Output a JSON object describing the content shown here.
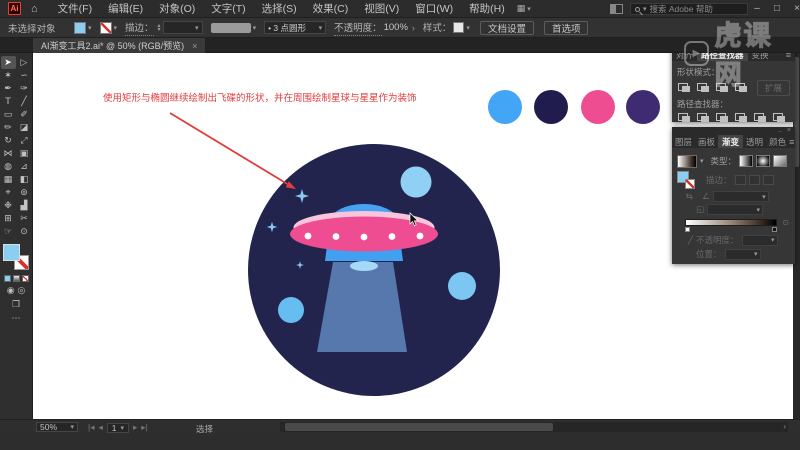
{
  "colors": {
    "annotation-red": "#e23c3c",
    "ui-blue": "#8bcef2",
    "art-circle": "#23244e",
    "art-dome": "#47a3f2",
    "art-saucer": "#ee4d92",
    "art-highlight": "#f8c6dc",
    "art-neck": "#41a0f0",
    "art-under": "#a6d8f7",
    "art-beam": "#5778ad",
    "art-planet-1": "#8fd0f4",
    "art-planet-2": "#7cc7f2",
    "art-planet-3": "#66bdf0",
    "art-sparkle": "#86c9f1",
    "art-dot": "#ffffff",
    "swatch-1": "#42a5f5",
    "swatch-2": "#211c4e",
    "swatch-3": "#ee4d92",
    "swatch-4": "#3f2b71"
  },
  "icons": {
    "logo": "Ai",
    "home": "⌂",
    "workspace": "▦",
    "caret": "▾",
    "stepper_up": "▴",
    "stepper_down": "▾",
    "chevron_right": "›",
    "close": "×",
    "mini_dots": "..",
    "hamburger": "≡",
    "angle": "∠",
    "aspect": "◱",
    "reverse": "⇆",
    "eyedropper": "╱",
    "annotate": "⊙",
    "draw_normal": "◉",
    "draw_behind": "◎",
    "screen_mode": "❐",
    "ellipsis": "⋯",
    "play": "▶",
    "scroll_right": "›"
  },
  "menu_bar": {
    "items": [
      "文件(F)",
      "编辑(E)",
      "对象(O)",
      "文字(T)",
      "选择(S)",
      "效果(C)",
      "视图(V)",
      "窗口(W)",
      "帮助(H)"
    ],
    "search_text": "搜索 Adobe 帮助",
    "window_buttons": {
      "minimize": "–",
      "maximize": "□",
      "close": "×"
    }
  },
  "control_bar": {
    "selection_status": "未选择对象",
    "stroke_label": "描边：",
    "brush_name": "• 3 点圆形",
    "opacity_label": "不透明度：",
    "opacity_value": "100%",
    "style_label": "样式：",
    "document_setup": "文档设置",
    "preferences": "首选项"
  },
  "document_tab": {
    "title": "AI渐变工具2.ai* @ 50% (RGB/预览)",
    "close": "×"
  },
  "toolbar": {
    "tools": [
      {
        "name": "selection",
        "glyph": "➤"
      },
      {
        "name": "direct-selection",
        "glyph": "▷"
      },
      {
        "name": "magic-wand",
        "glyph": "✶"
      },
      {
        "name": "lasso",
        "glyph": "∽"
      },
      {
        "name": "pen",
        "glyph": "✒"
      },
      {
        "name": "curvature",
        "glyph": "✑"
      },
      {
        "name": "type",
        "glyph": "T"
      },
      {
        "name": "line-segment",
        "glyph": "╱"
      },
      {
        "name": "rectangle",
        "glyph": "▭"
      },
      {
        "name": "paintbrush",
        "glyph": "✐"
      },
      {
        "name": "pencil",
        "glyph": "✏"
      },
      {
        "name": "eraser",
        "glyph": "◪"
      },
      {
        "name": "rotate",
        "glyph": "↻"
      },
      {
        "name": "scale",
        "glyph": "⤢"
      },
      {
        "name": "width",
        "glyph": "⋈"
      },
      {
        "name": "free-transform",
        "glyph": "▣"
      },
      {
        "name": "shape-builder",
        "glyph": "◍"
      },
      {
        "name": "perspective-grid",
        "glyph": "⊿"
      },
      {
        "name": "mesh",
        "glyph": "▦"
      },
      {
        "name": "gradient",
        "glyph": "◧"
      },
      {
        "name": "eyedropper",
        "glyph": "⌖"
      },
      {
        "name": "blend",
        "glyph": "⊚"
      },
      {
        "name": "symbol-sprayer",
        "glyph": "❉"
      },
      {
        "name": "column-graph",
        "glyph": "▟"
      },
      {
        "name": "artboard",
        "glyph": "⊞"
      },
      {
        "name": "slice",
        "glyph": "✂"
      },
      {
        "name": "hand",
        "glyph": "☞"
      },
      {
        "name": "zoom",
        "glyph": "⊙"
      }
    ]
  },
  "canvas": {
    "annotation": "使用矩形与椭圆继续绘制出飞碟的形状，并在周围绘制星球与星星作为装饰"
  },
  "panels": {
    "pathfinder": {
      "tabs": [
        "对齐",
        "路径查找器",
        "变换"
      ],
      "active_tab": "路径查找器",
      "shape_modes_label": "形状模式：",
      "pathfinder_label": "路径查找器：",
      "expand_button": "扩展"
    },
    "gradient": {
      "tabs": [
        "图层",
        "画板",
        "渐变",
        "透明",
        "颜色"
      ],
      "active_tab": "渐变",
      "type_label": "类型：",
      "stroke_label": "描边：",
      "opacity_label": "不透明度：",
      "location_label": "位置："
    }
  },
  "status_bar": {
    "zoom": "50%",
    "nav_first": "|◂",
    "nav_prev": "◂",
    "artboard": "1",
    "nav_next": "▸",
    "nav_last": "▸|",
    "tool_name": "选择"
  },
  "watermark": {
    "text": "虎课网"
  }
}
